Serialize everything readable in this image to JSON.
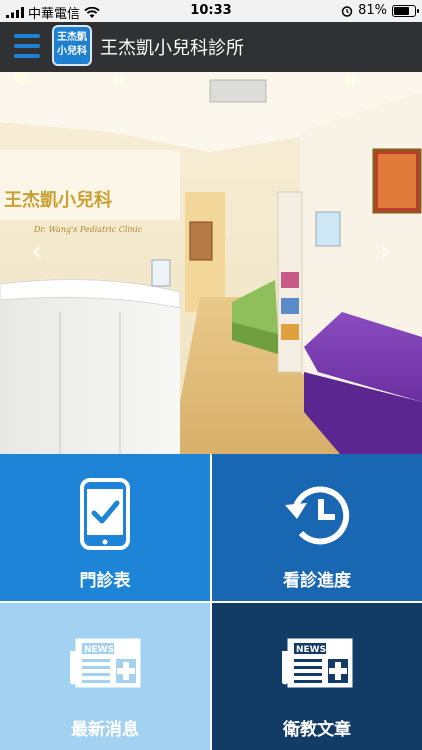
{
  "status_bar": {
    "carrier": "中華電信",
    "time": "10:33",
    "battery": "81%",
    "battery_level": 0.81
  },
  "header": {
    "logo_text_line1": "王杰凱",
    "logo_text_line2": "小兒科",
    "title": "王杰凱小兒科診所"
  },
  "hero": {
    "reception_sign": "王杰凱小兒科",
    "reception_sign_en": "Dr. Wang's Pediatric Clinic",
    "prev_arrow": "‹",
    "next_arrow": "›"
  },
  "tiles": [
    {
      "label": "門診表",
      "icon": "phone-check-icon",
      "color": "#1e84d8"
    },
    {
      "label": "看診進度",
      "icon": "history-icon",
      "color": "#1966b2"
    },
    {
      "label": "最新消息",
      "icon": "news-icon",
      "color": "#a2d1f1"
    },
    {
      "label": "衛教文章",
      "icon": "news-icon",
      "color": "#123c66"
    }
  ]
}
